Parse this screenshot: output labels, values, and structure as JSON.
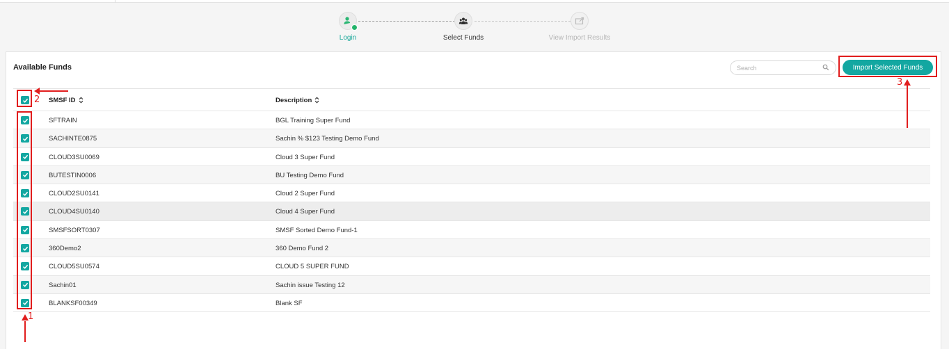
{
  "stepper": {
    "steps": [
      {
        "label": "Login",
        "icon": "user-check-icon",
        "state": "completed"
      },
      {
        "label": "Select Funds",
        "icon": "users-group-icon",
        "state": "current"
      },
      {
        "label": "View Import Results",
        "icon": "import-results-icon",
        "state": "pending"
      }
    ]
  },
  "panel": {
    "title": "Available Funds",
    "search_placeholder": "Search",
    "search_value": "",
    "import_button_label": "Import Selected Funds"
  },
  "table": {
    "columns": [
      "SMSF ID",
      "Description"
    ],
    "select_all_checked": true,
    "rows": [
      {
        "id": "SFTRAIN",
        "description": "BGL Training Super Fund",
        "checked": true
      },
      {
        "id": "SACHINTE0875",
        "description": "Sachin % $123 Testing Demo Fund",
        "checked": true
      },
      {
        "id": "CLOUD3SU0069",
        "description": "Cloud 3 Super Fund",
        "checked": true
      },
      {
        "id": "BUTESTIN0006",
        "description": "BU Testing Demo Fund",
        "checked": true
      },
      {
        "id": "CLOUD2SU0141",
        "description": "Cloud 2 Super Fund",
        "checked": true
      },
      {
        "id": "CLOUD4SU0140",
        "description": "Cloud 4 Super Fund",
        "checked": true
      },
      {
        "id": "SMSFSORT0307",
        "description": "SMSF Sorted Demo Fund-1",
        "checked": true
      },
      {
        "id": "360Demo2",
        "description": "360 Demo Fund 2",
        "checked": true
      },
      {
        "id": "CLOUD5SU0574",
        "description": "CLOUD 5 SUPER FUND",
        "checked": true
      },
      {
        "id": "Sachin01",
        "description": "Sachin issue Testing 12",
        "checked": true
      },
      {
        "id": "BLANKSF00349",
        "description": "Blank SF",
        "checked": true
      }
    ]
  },
  "annotations": {
    "one": "1",
    "two": "2",
    "three": "3"
  },
  "colors": {
    "accent": "#13a7a1",
    "annotation": "#e11d1d",
    "login_step": "#19a89a",
    "check_dot": "#24b36a"
  }
}
